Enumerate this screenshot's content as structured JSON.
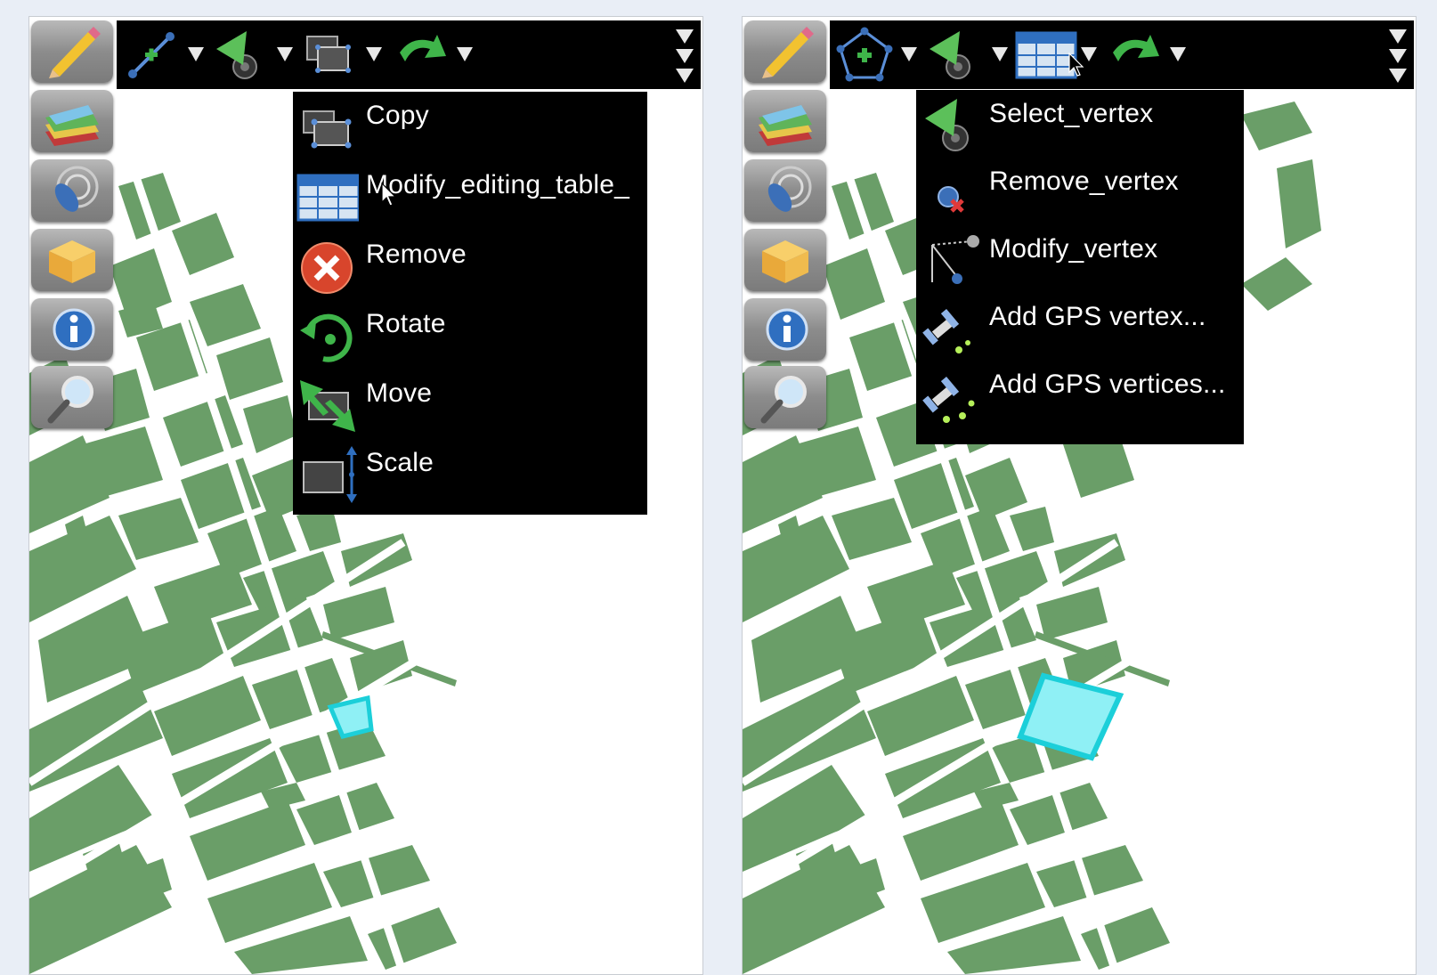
{
  "left_screen": {
    "menu": {
      "items": [
        {
          "label": "Copy",
          "icon": "copy-icon"
        },
        {
          "label": "Modify_editing_table_",
          "icon": "table-icon"
        },
        {
          "label": "Remove",
          "icon": "remove-icon"
        },
        {
          "label": "Rotate",
          "icon": "rotate-icon"
        },
        {
          "label": "Move",
          "icon": "move-icon"
        },
        {
          "label": "Scale",
          "icon": "scale-icon"
        }
      ]
    }
  },
  "right_screen": {
    "menu": {
      "items": [
        {
          "label": "Select_vertex",
          "icon": "select-vertex-icon"
        },
        {
          "label": "Remove_vertex",
          "icon": "remove-vertex-icon"
        },
        {
          "label": "Modify_vertex",
          "icon": "modify-vertex-icon"
        },
        {
          "label": "Add GPS vertex...",
          "icon": "gps-satellite-icon"
        },
        {
          "label": "Add GPS vertices...",
          "icon": "gps-satellite-icon"
        }
      ]
    }
  },
  "sidebar_icons": [
    "pencil-icon",
    "layers-icon",
    "gps-dish-icon",
    "package-icon",
    "info-icon",
    "magnifier-icon"
  ],
  "colors": {
    "toolbar": "#000000",
    "map_blocks": "#6a9e68",
    "map_background": "#ffffff",
    "selection_fill": "#8ff0f5",
    "selection_stroke": "#1ccfd9",
    "accent_green": "#3fb54a",
    "accent_blue": "#2f6fc0"
  }
}
